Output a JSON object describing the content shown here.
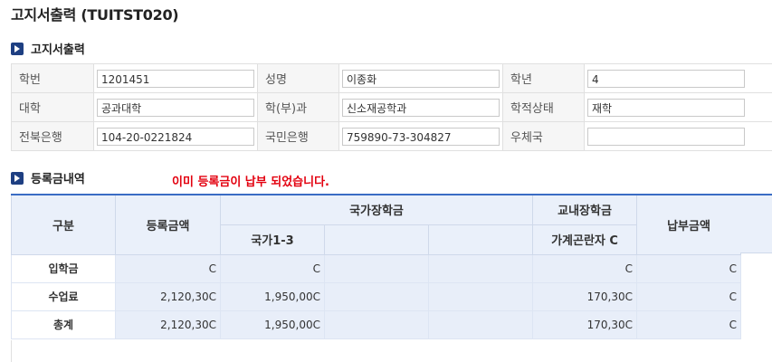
{
  "page": {
    "title": "고지서출력 (TUITST020)"
  },
  "section1": {
    "title": "고지서출력"
  },
  "info": {
    "rows": [
      [
        {
          "label": "학번",
          "value": "1201451"
        },
        {
          "label": "성명",
          "value": "이종화"
        },
        {
          "label": "학년",
          "value": "4"
        }
      ],
      [
        {
          "label": "대학",
          "value": "공과대학"
        },
        {
          "label": "학(부)과",
          "value": "신소재공학과"
        },
        {
          "label": "학적상태",
          "value": "재학"
        }
      ],
      [
        {
          "label": "전북은행",
          "value": "104-20-0221824"
        },
        {
          "label": "국민은행",
          "value": "759890-73-304827"
        },
        {
          "label": "우체국",
          "value": ""
        }
      ]
    ]
  },
  "section2": {
    "title": "등록금내역",
    "notice": "이미 등록금이 납부 되었습니다."
  },
  "grid": {
    "headers": {
      "category": "구분",
      "tuition": "등록금액",
      "national": "국가장학금",
      "campus": "교내장학금",
      "paid": "납부금액",
      "national_sub1": "국가1-3",
      "campus_sub1": "가계곤란자 C"
    },
    "rows": [
      {
        "label": "입학금",
        "tuition": "C",
        "national1": "C",
        "campus1": "C",
        "paid": "C"
      },
      {
        "label": "수업료",
        "tuition": "2,120,30C",
        "national1": "1,950,00C",
        "campus1": "170,30C",
        "paid": "C"
      },
      {
        "label": "총계",
        "tuition": "2,120,30C",
        "national1": "1,950,00C",
        "campus1": "170,30C",
        "paid": "C"
      }
    ]
  },
  "colors": {
    "accent": "#1e3f82",
    "header_bg": "#eaf0fa",
    "notice": "#e3000f"
  }
}
